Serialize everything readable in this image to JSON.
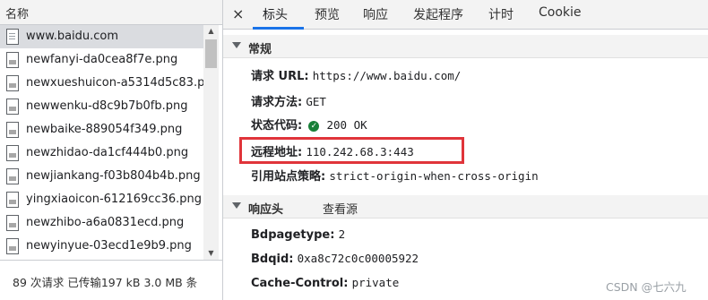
{
  "request_list": {
    "header": "名称",
    "items": [
      {
        "name": "www.baidu.com",
        "type": "doc"
      },
      {
        "name": "newfanyi-da0cea8f7e.png",
        "type": "img"
      },
      {
        "name": "newxueshuicon-a5314d5c83.p",
        "type": "img"
      },
      {
        "name": "newwenku-d8c9b7b0fb.png",
        "type": "img"
      },
      {
        "name": "newbaike-889054f349.png",
        "type": "img"
      },
      {
        "name": "newzhidao-da1cf444b0.png",
        "type": "img"
      },
      {
        "name": "newjiankang-f03b804b4b.png",
        "type": "img"
      },
      {
        "name": "yingxiaoicon-612169cc36.png",
        "type": "img"
      },
      {
        "name": "newzhibo-a6a0831ecd.png",
        "type": "img"
      },
      {
        "name": "newyinyue-03ecd1e9b9.png",
        "type": "img"
      }
    ],
    "selected_index": 0
  },
  "status_bar": "89 次请求  已传输197 kB  3.0 MB 条",
  "tabs": {
    "close": "×",
    "items": [
      "标头",
      "预览",
      "响应",
      "发起程序",
      "计时",
      "Cookie"
    ],
    "active": "标头"
  },
  "general": {
    "title": "常规",
    "url_label": "请求 URL:",
    "url_value": "https://www.baidu.com/",
    "method_label": "请求方法:",
    "method_value": "GET",
    "status_label": "状态代码:",
    "status_icon": "✓",
    "status_value": "200 OK",
    "remote_label": "远程地址:",
    "remote_value": "110.242.68.3:443",
    "referrer_label": "引用站点策略:",
    "referrer_value": "strict-origin-when-cross-origin"
  },
  "response_headers": {
    "title": "响应头",
    "view_source": "查看源",
    "items": [
      {
        "key": "Bdpagetype:",
        "value": "2"
      },
      {
        "key": "Bdqid:",
        "value": "0xa8c72c0c00005922"
      },
      {
        "key": "Cache-Control:",
        "value": "private"
      }
    ]
  },
  "scroll_icons": {
    "up": "▲",
    "down": "▼"
  },
  "watermark": "CSDN @七六九",
  "colors": {
    "accent": "#1a73e8",
    "highlight_box": "#e0343a",
    "status_ok": "#188038"
  }
}
